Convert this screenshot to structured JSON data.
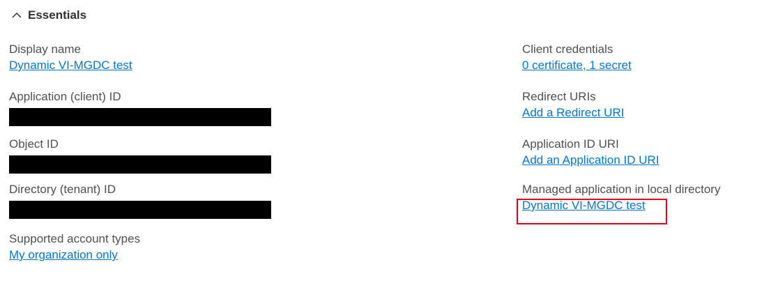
{
  "essentials": {
    "title": "Essentials",
    "toggle_icon": "chevron-up-icon"
  },
  "left_fields": {
    "display_name": {
      "label": "Display name",
      "value": "Dynamic VI-MGDC test"
    },
    "application_client_id": {
      "label": "Application (client) ID",
      "value": ""
    },
    "object_id": {
      "label": "Object ID",
      "value": ""
    },
    "directory_tenant_id": {
      "label": "Directory (tenant) ID",
      "value": ""
    },
    "supported_account_types": {
      "label": "Supported account types",
      "value": "My organization only"
    }
  },
  "right_fields": {
    "client_credentials": {
      "label": "Client credentials",
      "value": "0 certificate, 1 secret"
    },
    "redirect_uris": {
      "label": "Redirect URIs",
      "value": "Add a Redirect URI"
    },
    "application_id_uri": {
      "label": "Application ID URI",
      "value": "Add an Application ID URI"
    },
    "managed_application": {
      "label": "Managed application in local directory",
      "value": "Dynamic VI-MGDC test"
    }
  },
  "colors": {
    "link": "#0078d4",
    "label": "#505050",
    "highlight_border": "#e3001b",
    "redaction": "#000000"
  }
}
